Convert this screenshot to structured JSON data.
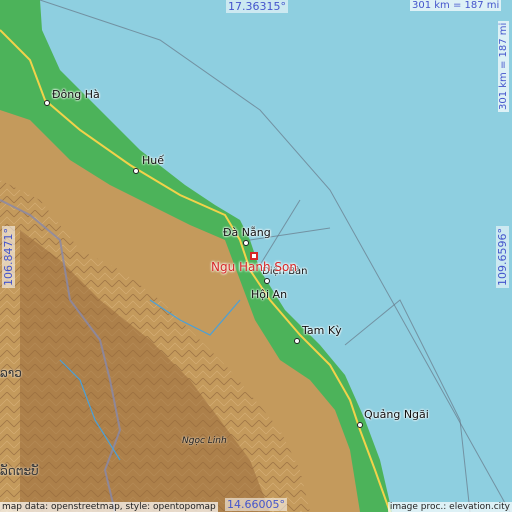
{
  "map": {
    "sea_color": "#8ecfe0",
    "lowland_color": "#4cb35a",
    "highland_color": "#c49a5c",
    "mountain_color": "#9a6b3c",
    "target_color": "#d62828"
  },
  "coordinates": {
    "top": "17.36315°",
    "bottom": "14.66005°",
    "left": "106.8471°",
    "right": "109.6596°"
  },
  "scale": {
    "top": "301 km = 187 mi",
    "right": "301 km = 187 mi"
  },
  "target": {
    "name": "Ngu Hanh Son"
  },
  "cities": [
    {
      "id": "dong-ha",
      "name": "Đông Hà"
    },
    {
      "id": "hue",
      "name": "Huế"
    },
    {
      "id": "da-nang",
      "name": "Đà Nẵng"
    },
    {
      "id": "dien-ban",
      "name": "Điện Bàn"
    },
    {
      "id": "hoi-an",
      "name": "Hội An"
    },
    {
      "id": "tam-ky",
      "name": "Tam Kỳ"
    },
    {
      "id": "quang-ngai",
      "name": "Quảng Ngãi"
    }
  ],
  "laos_labels": [
    "ລາວ",
    "ລັດຕະບັ"
  ],
  "peak": "Ngọc Linh",
  "credits": {
    "left": "map data: openstreetmap, style: opentopomap",
    "right": "image proc.: elevation.city"
  }
}
